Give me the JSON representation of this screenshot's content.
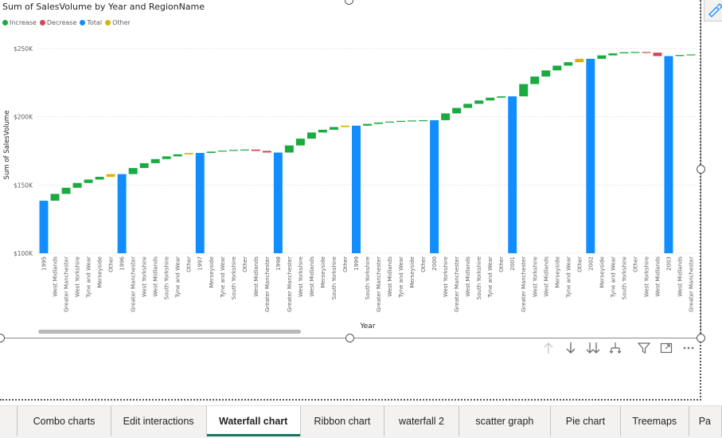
{
  "chart_title": "Sum of SalesVolume by Year and RegionName",
  "legend": [
    {
      "label": "Increase",
      "color": "#1aab40"
    },
    {
      "label": "Decrease",
      "color": "#d64554"
    },
    {
      "label": "Total",
      "color": "#118dff"
    },
    {
      "label": "Other",
      "color": "#d9b300"
    }
  ],
  "tabs": [
    "Combo charts",
    "Edit interactions",
    "Waterfall chart",
    "Ribbon chart",
    "waterfall 2",
    "scatter graph",
    "Pie chart",
    "Treemaps",
    "Pa"
  ],
  "active_tab": "Waterfall chart",
  "toolbar_icons": [
    "arrow-up-icon",
    "arrow-down-icon",
    "double-arrow-down-icon",
    "expand-hierarchy-icon",
    "filter-icon",
    "focus-mode-icon",
    "more-options-icon"
  ],
  "chart_data": {
    "type": "waterfall",
    "title": "Sum of SalesVolume by Year and RegionName",
    "xlabel": "Year",
    "ylabel": "Sum of SalesVolume",
    "ylim": [
      100000,
      250000
    ],
    "yticks": [
      100000,
      150000,
      200000,
      250000
    ],
    "ytick_labels": [
      "$100K",
      "$150K",
      "$200K",
      "$250K"
    ],
    "grid": true,
    "legend_position": "top-left",
    "colors": {
      "Increase": "#1aab40",
      "Decrease": "#d64554",
      "Total": "#118dff",
      "Other": "#d9b300"
    },
    "items": [
      {
        "label": "1995",
        "kind": "Total",
        "start": 100000,
        "end": 138500
      },
      {
        "label": "West Midlands",
        "kind": "Increase",
        "start": 138500,
        "end": 143500
      },
      {
        "label": "Greater Manchester",
        "kind": "Increase",
        "start": 143500,
        "end": 148000
      },
      {
        "label": "West Yorkshire",
        "kind": "Increase",
        "start": 148000,
        "end": 151500
      },
      {
        "label": "Tyne and Wear",
        "kind": "Increase",
        "start": 151500,
        "end": 154000
      },
      {
        "label": "Merseyside",
        "kind": "Increase",
        "start": 154000,
        "end": 156000
      },
      {
        "label": "Other",
        "kind": "Other",
        "start": 156000,
        "end": 158000
      },
      {
        "label": "1996",
        "kind": "Total",
        "start": 100000,
        "end": 158000
      },
      {
        "label": "Greater Manchester",
        "kind": "Increase",
        "start": 158000,
        "end": 162500
      },
      {
        "label": "West Yorkshire",
        "kind": "Increase",
        "start": 162500,
        "end": 166000
      },
      {
        "label": "West Midlands",
        "kind": "Increase",
        "start": 166000,
        "end": 169000
      },
      {
        "label": "South Yorkshire",
        "kind": "Increase",
        "start": 169000,
        "end": 171000
      },
      {
        "label": "Tyne and Wear",
        "kind": "Increase",
        "start": 171000,
        "end": 172500
      },
      {
        "label": "Other",
        "kind": "Other",
        "start": 172500,
        "end": 173500
      },
      {
        "label": "1997",
        "kind": "Total",
        "start": 100000,
        "end": 173500
      },
      {
        "label": "Merseyside",
        "kind": "Increase",
        "start": 173500,
        "end": 174500
      },
      {
        "label": "Tyne and Wear",
        "kind": "Increase",
        "start": 174500,
        "end": 175200
      },
      {
        "label": "South Yorkshire",
        "kind": "Increase",
        "start": 175200,
        "end": 175700
      },
      {
        "label": "Other",
        "kind": "Increase",
        "start": 175700,
        "end": 176000
      },
      {
        "label": "West Midlands",
        "kind": "Decrease",
        "start": 176000,
        "end": 175000
      },
      {
        "label": "Greater Manchester",
        "kind": "Decrease",
        "start": 175000,
        "end": 173800
      },
      {
        "label": "1998",
        "kind": "Total",
        "start": 100000,
        "end": 173800
      },
      {
        "label": "Greater Manchester",
        "kind": "Increase",
        "start": 173800,
        "end": 179000
      },
      {
        "label": "West Yorkshire",
        "kind": "Increase",
        "start": 179000,
        "end": 184000
      },
      {
        "label": "West Midlands",
        "kind": "Increase",
        "start": 184000,
        "end": 188500
      },
      {
        "label": "Merseyside",
        "kind": "Increase",
        "start": 188500,
        "end": 190500
      },
      {
        "label": "South Yorkshire",
        "kind": "Increase",
        "start": 190500,
        "end": 192500
      },
      {
        "label": "Other",
        "kind": "Other",
        "start": 192500,
        "end": 193500
      },
      {
        "label": "1999",
        "kind": "Total",
        "start": 100000,
        "end": 193500
      },
      {
        "label": "South Yorkshire",
        "kind": "Increase",
        "start": 193500,
        "end": 194800
      },
      {
        "label": "Greater Manchester",
        "kind": "Increase",
        "start": 194800,
        "end": 195800
      },
      {
        "label": "West Midlands",
        "kind": "Increase",
        "start": 195800,
        "end": 196500
      },
      {
        "label": "Tyne and Wear",
        "kind": "Increase",
        "start": 196500,
        "end": 197000
      },
      {
        "label": "Merseyside",
        "kind": "Increase",
        "start": 197000,
        "end": 197300
      },
      {
        "label": "Other",
        "kind": "Increase",
        "start": 197300,
        "end": 197500
      },
      {
        "label": "2000",
        "kind": "Total",
        "start": 100000,
        "end": 197500
      },
      {
        "label": "West Yorkshire",
        "kind": "Increase",
        "start": 197500,
        "end": 202500
      },
      {
        "label": "Greater Manchester",
        "kind": "Increase",
        "start": 202500,
        "end": 206500
      },
      {
        "label": "West Midlands",
        "kind": "Increase",
        "start": 206500,
        "end": 209500
      },
      {
        "label": "South Yorkshire",
        "kind": "Increase",
        "start": 209500,
        "end": 212000
      },
      {
        "label": "Tyne and Wear",
        "kind": "Increase",
        "start": 212000,
        "end": 214000
      },
      {
        "label": "Other",
        "kind": "Increase",
        "start": 214000,
        "end": 215000
      },
      {
        "label": "2001",
        "kind": "Total",
        "start": 100000,
        "end": 215000
      },
      {
        "label": "Greater Manchester",
        "kind": "Increase",
        "start": 215000,
        "end": 224000
      },
      {
        "label": "West Yorkshire",
        "kind": "Increase",
        "start": 224000,
        "end": 229500
      },
      {
        "label": "West Midlands",
        "kind": "Increase",
        "start": 229500,
        "end": 234000
      },
      {
        "label": "Merseyside",
        "kind": "Increase",
        "start": 234000,
        "end": 237500
      },
      {
        "label": "Tyne and Wear",
        "kind": "Increase",
        "start": 237500,
        "end": 240000
      },
      {
        "label": "Other",
        "kind": "Other",
        "start": 240000,
        "end": 242500
      },
      {
        "label": "2002",
        "kind": "Total",
        "start": 100000,
        "end": 242500
      },
      {
        "label": "Merseyside",
        "kind": "Increase",
        "start": 242500,
        "end": 245000
      },
      {
        "label": "Tyne and Wear",
        "kind": "Increase",
        "start": 245000,
        "end": 246500
      },
      {
        "label": "South Yorkshire",
        "kind": "Increase",
        "start": 246500,
        "end": 247300
      },
      {
        "label": "Other",
        "kind": "Increase",
        "start": 247300,
        "end": 247500
      },
      {
        "label": "West Yorkshire",
        "kind": "Decrease",
        "start": 247500,
        "end": 247000
      },
      {
        "label": "West Midlands",
        "kind": "Decrease",
        "start": 247000,
        "end": 244500
      },
      {
        "label": "2003",
        "kind": "Total",
        "start": 100000,
        "end": 244500
      },
      {
        "label": "West Midlands",
        "kind": "Increase",
        "start": 244500,
        "end": 245300
      },
      {
        "label": "Greater Manchester",
        "kind": "Increase",
        "start": 245300,
        "end": 245700
      }
    ]
  }
}
